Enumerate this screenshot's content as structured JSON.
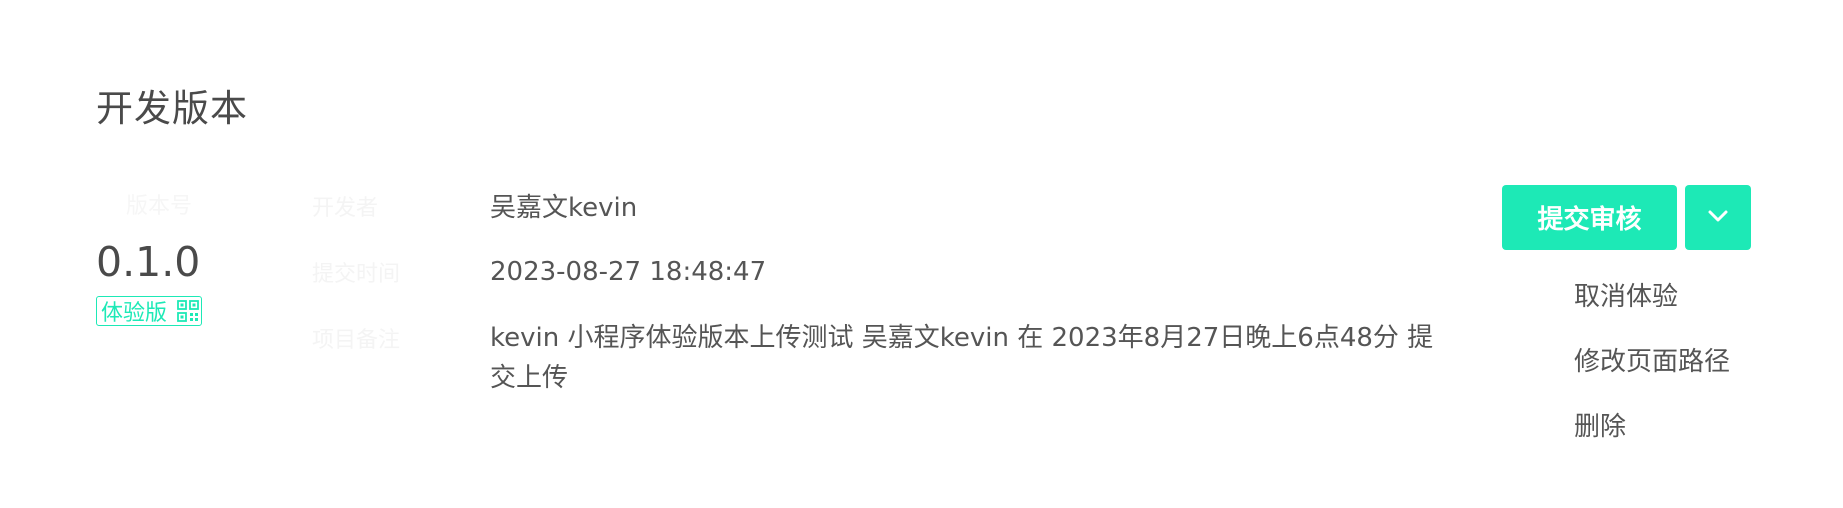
{
  "section": {
    "title": "开发版本"
  },
  "version": {
    "label": "版本号",
    "number": "0.1.0",
    "tag_label": "体验版"
  },
  "fields": {
    "labels": [
      "开发者",
      "提交时间",
      "项目备注"
    ]
  },
  "info": {
    "developer": "吴嘉文kevin",
    "submit_time": "2023-08-27 18:48:47",
    "description": "kevin 小程序体验版本上传测试 吴嘉文kevin 在 2023年8月27日晚上6点48分 提交上传"
  },
  "actions": {
    "submit_label": "提交审核",
    "menu": [
      {
        "label": "取消体验"
      },
      {
        "label": "修改页面路径"
      },
      {
        "label": "删除"
      }
    ]
  },
  "colors": {
    "accent": "#1de9b6",
    "text": "#555555",
    "title": "#4a4a4a"
  }
}
